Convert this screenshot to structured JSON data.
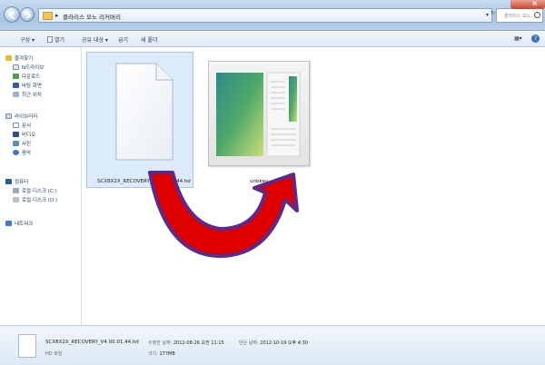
{
  "window": {
    "address_path": "클라리스 모노 리커버리",
    "search_placeholder": "클라리스 모노..."
  },
  "toolbar": {
    "organize": "구성 ▾",
    "open": "열기",
    "share": "공유 대상 ▾",
    "burn": "굽기",
    "new_folder": "새 폴더"
  },
  "sidebar": {
    "favorites": {
      "header": "즐겨찾기",
      "items": [
        "N드라이브",
        "다운로드",
        "바탕 화면",
        "최근 위치"
      ]
    },
    "libraries": {
      "header": "라이브러리",
      "items": [
        "문서",
        "비디오",
        "사진",
        "음악"
      ]
    },
    "computer": {
      "header": "컴퓨터",
      "items": [
        "로컬 디스크 (C:)",
        "로컬 디스크 (D:)"
      ]
    },
    "network": {
      "header": "네트워크"
    }
  },
  "files": [
    {
      "name": "SCX8X2X_RECOVERY_V4.00.01.44.hd",
      "icon": "blank-document-icon",
      "selected": true
    },
    {
      "name": "unbkey",
      "icon": "program-window-icon",
      "selected": false
    }
  ],
  "details": {
    "filename": "SCX8X2X_RECOVERY_V4.00.01.44.hd",
    "filetype": "HD 파일",
    "modified_label": "수정한 날짜:",
    "modified_value": "2012-08-26 오전 11:15",
    "created_label": "만든 날짜:",
    "created_value": "2012-10-19 오후 4:30",
    "size_label": "크기:",
    "size_value": "177MB"
  },
  "annotation": {
    "arrow_fill": "#e00000",
    "arrow_outline": "#5b2a8c"
  }
}
